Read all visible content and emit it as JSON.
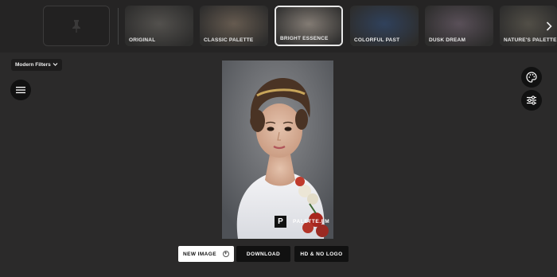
{
  "filter_strip": {
    "thumbnails": [
      {
        "label": "ORIGINAL",
        "tone": "#7e7a74",
        "selected": false
      },
      {
        "label": "CLASSIC PALETTE",
        "tone": "#a08c78",
        "selected": false
      },
      {
        "label": "BRIGHT ESSENCE",
        "tone": "#a49a90",
        "selected": true
      },
      {
        "label": "COLORFUL PAST",
        "tone": "#3e5e8e",
        "selected": false
      },
      {
        "label": "DUSK DREAM",
        "tone": "#8a7888",
        "selected": false
      },
      {
        "label": "NATURE'S PALETTE",
        "tone": "#7c7668",
        "selected": false
      }
    ]
  },
  "filter_select": {
    "value": "Modern Filters"
  },
  "watermark": {
    "logo_letter": "P",
    "text": "PALETTE.FM"
  },
  "actions": {
    "new_image": "NEW IMAGE",
    "new_image_icon": "+",
    "download": "DOWNLOAD",
    "hd_no_logo": "HD & NO LOGO"
  }
}
